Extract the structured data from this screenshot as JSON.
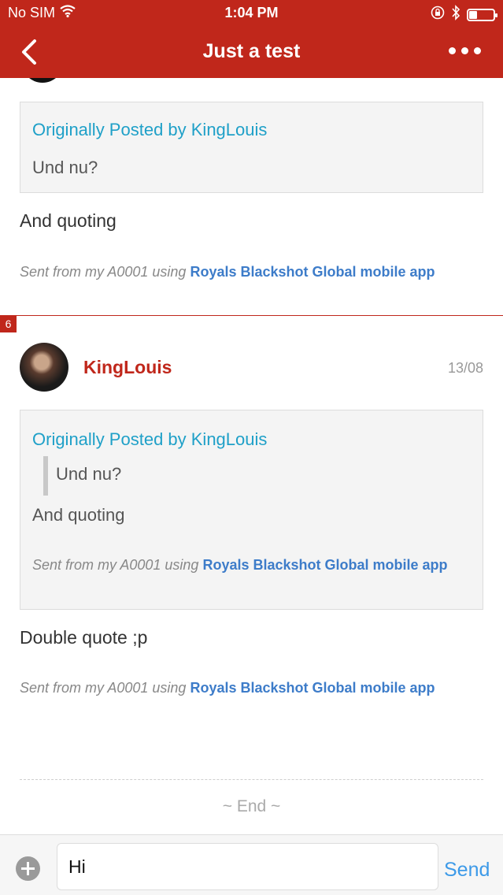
{
  "status_bar": {
    "carrier": "No SIM",
    "time": "1:04 PM"
  },
  "nav": {
    "title": "Just a test"
  },
  "posts": [
    {
      "quote_by": "Originally Posted by KingLouis",
      "quote_text": "Und nu?",
      "text": "And quoting",
      "signature_prefix": "Sent from my A0001 using ",
      "signature_link": "Royals Blackshot Global mobile app"
    },
    {
      "number": "6",
      "author": "KingLouis",
      "date": "13/08",
      "quote_by": "Originally Posted by KingLouis",
      "nested_quote_text": "Und nu?",
      "quote_text": "And quoting",
      "quote_signature_prefix": "Sent from my A0001 using ",
      "quote_signature_link": "Royals Blackshot Global mobile app",
      "text": "Double quote ;p",
      "signature_prefix": "Sent from my A0001 using ",
      "signature_link": "Royals Blackshot Global mobile app"
    }
  ],
  "end_label": "~ End ~",
  "composer": {
    "value": "Hi",
    "send_label": "Send"
  },
  "colors": {
    "brand": "#c0271b",
    "quote_link": "#1fa0c8",
    "signature_link": "#3d7cc9",
    "send": "#3d9ae8"
  }
}
